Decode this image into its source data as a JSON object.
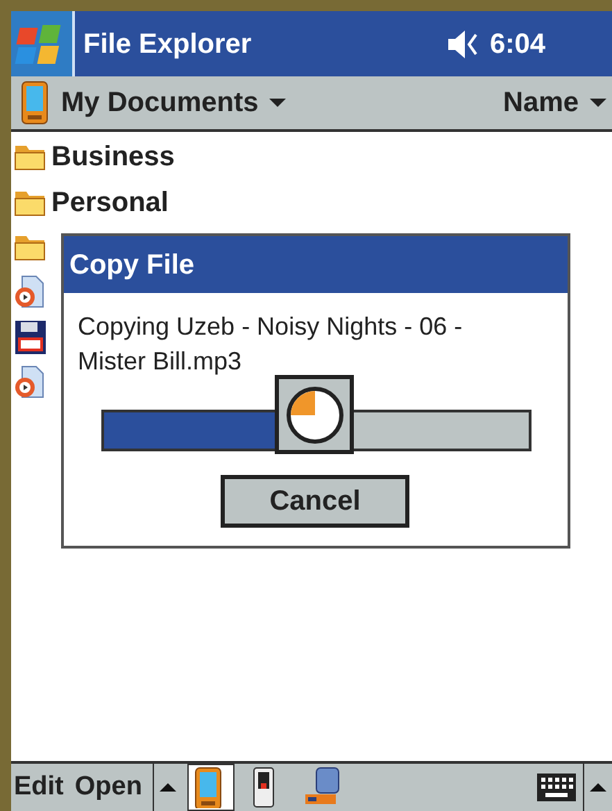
{
  "window": {
    "title": "File Explorer",
    "time": "6:04",
    "muted": false
  },
  "location": {
    "folder": "My Documents",
    "sort": "Name"
  },
  "files": [
    {
      "kind": "folder",
      "name": "Business"
    },
    {
      "kind": "folder",
      "name": "Personal"
    },
    {
      "kind": "folder"
    },
    {
      "kind": "media"
    },
    {
      "kind": "disk"
    },
    {
      "kind": "media"
    }
  ],
  "dialog": {
    "title": "Copy File",
    "message": "Copying Uzeb - Noisy Nights - 06 - Mister Bill.mp3",
    "level": 0.41,
    "button": "Cancel"
  },
  "menu_bar": {
    "items": [
      "Edit",
      "Open"
    ],
    "tray": [
      {
        "kind": "device",
        "selected": true
      },
      {
        "kind": "phone",
        "selected": false
      },
      {
        "kind": "network",
        "selected": false
      }
    ]
  }
}
